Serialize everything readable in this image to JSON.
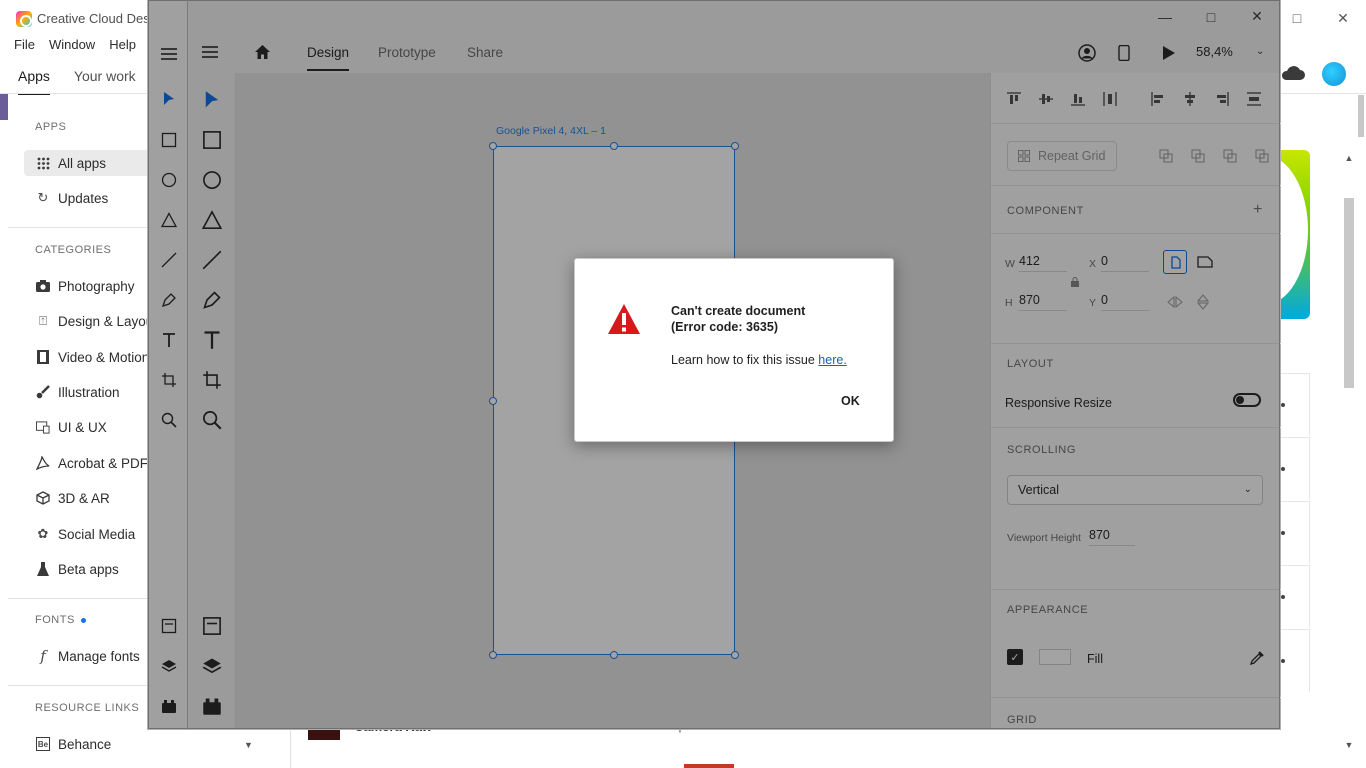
{
  "creative_cloud": {
    "title": "Creative Cloud Deskt",
    "menu": [
      "File",
      "Window",
      "Help"
    ],
    "tabs": [
      "Apps",
      "Your work"
    ],
    "sidebar": {
      "apps_heading": "APPS",
      "apps_items": [
        {
          "label": "All apps",
          "icon": "grid-icon"
        },
        {
          "label": "Updates",
          "icon": "refresh-icon"
        }
      ],
      "categories_heading": "CATEGORIES",
      "categories": [
        {
          "label": "Photography",
          "icon": "camera-icon"
        },
        {
          "label": "Design & Layout",
          "icon": "design-icon"
        },
        {
          "label": "Video & Motion",
          "icon": "film-icon"
        },
        {
          "label": "Illustration",
          "icon": "brush-icon"
        },
        {
          "label": "UI & UX",
          "icon": "ui-ux-icon"
        },
        {
          "label": "Acrobat & PDF",
          "icon": "acrobat-icon"
        },
        {
          "label": "3D & AR",
          "icon": "cube-icon"
        },
        {
          "label": "Social Media",
          "icon": "social-icon"
        },
        {
          "label": "Beta apps",
          "icon": "flask-icon"
        }
      ],
      "fonts_heading": "FONTS",
      "fonts_item": "Manage fonts",
      "resource_heading": "RESOURCE LINKS",
      "resource_item": "Behance"
    },
    "bottom_row": {
      "name": "Camera Raw",
      "status": "Up to date"
    }
  },
  "xd": {
    "nav_tabs": [
      "Design",
      "Prototype",
      "Share"
    ],
    "active_tab": "Design",
    "zoom": "58,4%",
    "artboard": {
      "name": "Google Pixel 4, 4XL – 1"
    },
    "props": {
      "repeat_grid": "Repeat Grid",
      "component_heading": "COMPONENT",
      "w_label": "W",
      "w_value": "412",
      "h_label": "H",
      "h_value": "870",
      "x_label": "X",
      "x_value": "0",
      "y_label": "Y",
      "y_value": "0",
      "layout_heading": "LAYOUT",
      "responsive_resize": "Responsive Resize",
      "scrolling_heading": "SCROLLING",
      "scrolling_value": "Vertical",
      "viewport_label": "Viewport Height",
      "viewport_value": "870",
      "appearance_heading": "APPEARANCE",
      "fill_label": "Fill",
      "grid_heading": "GRID"
    }
  },
  "dialog": {
    "title": "Can't create document",
    "code": "(Error code: 3635)",
    "help_text": "Learn how to fix this issue ",
    "help_link": "here.",
    "ok": "OK",
    "warn_color": "#d7191c"
  }
}
